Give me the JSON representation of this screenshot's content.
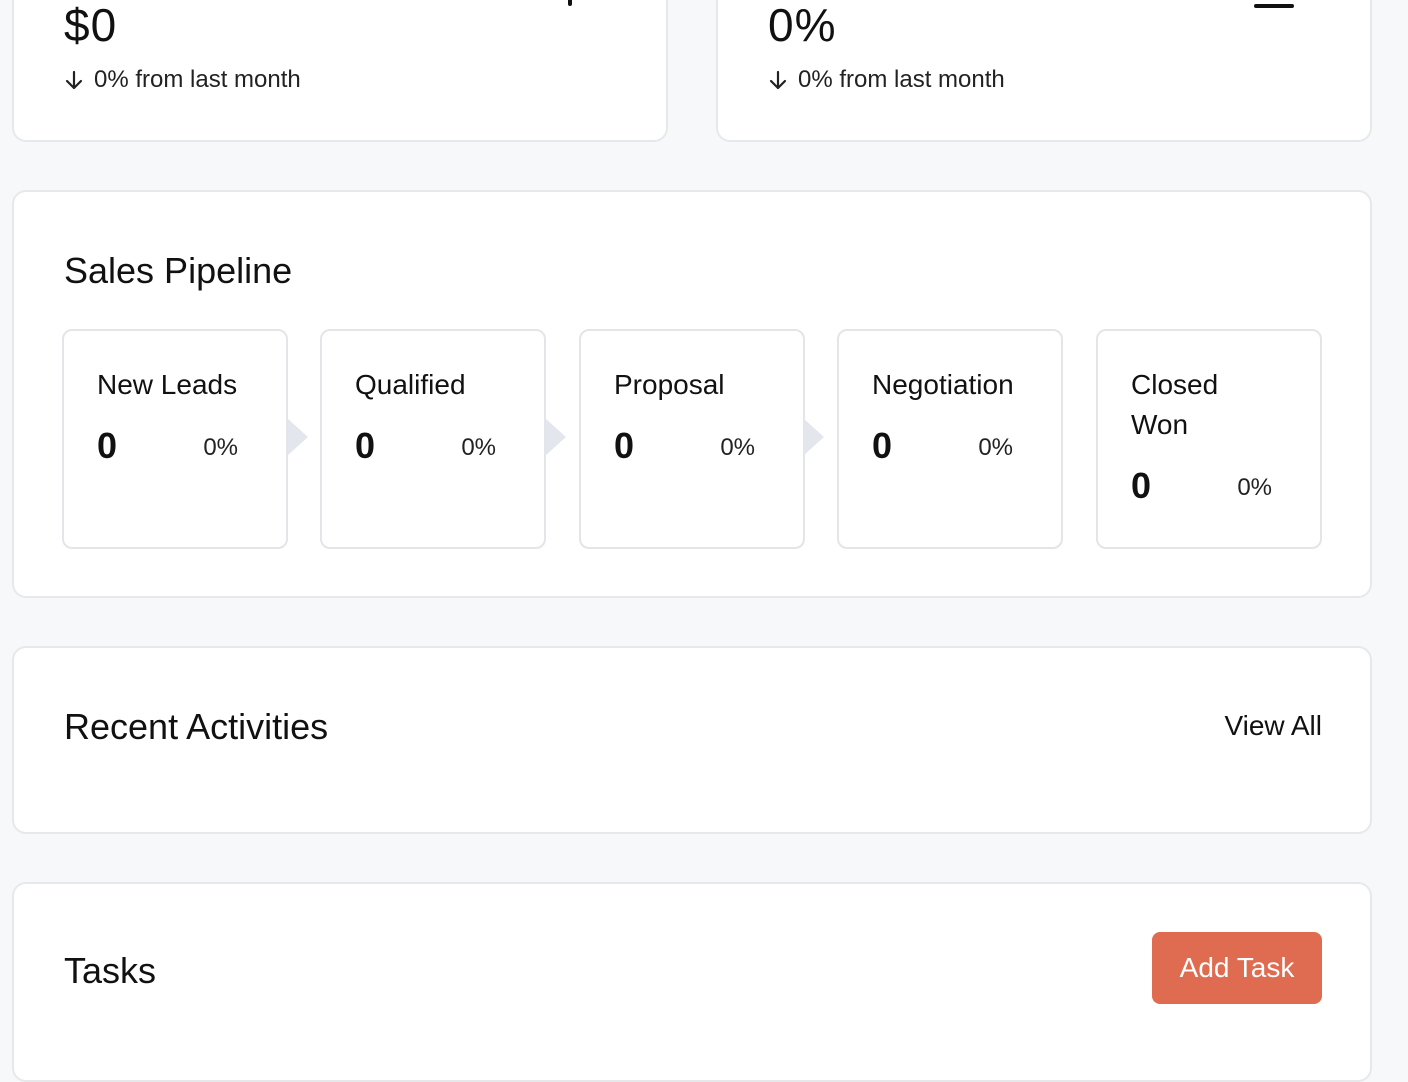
{
  "stats": [
    {
      "value": "$0",
      "change_label": "0% from last month",
      "icon": "dollar-icon"
    },
    {
      "value": "0%",
      "change_label": "0% from last month",
      "icon": "chart-bar-icon"
    }
  ],
  "pipeline": {
    "title": "Sales Pipeline",
    "stages": [
      {
        "name": "New Leads",
        "count": "0",
        "percent": "0%"
      },
      {
        "name": "Qualified",
        "count": "0",
        "percent": "0%"
      },
      {
        "name": "Proposal",
        "count": "0",
        "percent": "0%"
      },
      {
        "name": "Negotiation",
        "count": "0",
        "percent": "0%"
      },
      {
        "name": "Closed Won",
        "count": "0",
        "percent": "0%"
      }
    ]
  },
  "activities": {
    "title": "Recent Activities",
    "view_all_label": "View All"
  },
  "tasks": {
    "title": "Tasks",
    "add_label": "Add Task"
  },
  "colors": {
    "accent": "#df6c50",
    "card_border": "#e6e8ec",
    "background": "#f7f8fa"
  }
}
